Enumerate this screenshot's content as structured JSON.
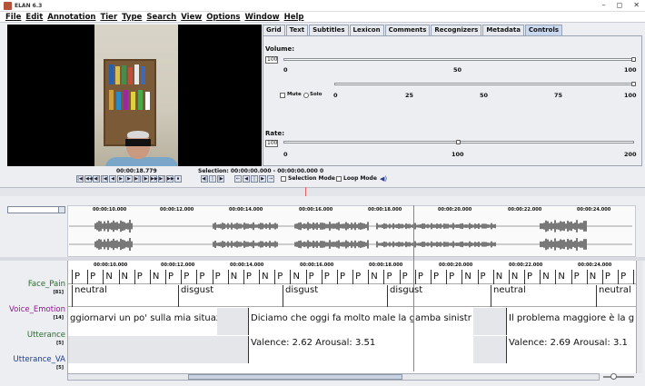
{
  "window": {
    "title": "ELAN 6.3",
    "controls": [
      "–",
      "◻",
      "✕"
    ]
  },
  "menu": [
    "File",
    "Edit",
    "Annotation",
    "Tier",
    "Type",
    "Search",
    "View",
    "Options",
    "Window",
    "Help"
  ],
  "player": {
    "media_time": "00:00:18.779",
    "selection": "Selection: 00:00:00.000 - 00:00:00.000  0",
    "selection_mode": "Selection Mode",
    "loop_mode": "Loop Mode"
  },
  "tabs": [
    "Grid",
    "Text",
    "Subtitles",
    "Lexicon",
    "Comments",
    "Recognizers",
    "Metadata",
    "Controls"
  ],
  "active_tab": "Controls",
  "controls": {
    "volume_label": "Volume:",
    "volume_value": "100",
    "volume_ticks": [
      "0",
      "50",
      "100"
    ],
    "volume_level": 100,
    "mute_label": "Mute",
    "solo_label": "Solo",
    "channel_ticks": [
      "0",
      "25",
      "50",
      "75",
      "100"
    ],
    "channel_level": 100,
    "rate_label": "Rate:",
    "rate_value": "100",
    "rate_ticks": [
      "0",
      "100",
      "200"
    ],
    "rate_level": 100
  },
  "timeline": {
    "timestamps": [
      "00:00:10.000",
      "00:00:12.000",
      "00:00:14.000",
      "00:00:16.000",
      "00:00:18.000",
      "00:00:20.000",
      "00:00:22.000",
      "00:00:24.000"
    ]
  },
  "tiers": [
    {
      "name": "Face_Pain",
      "count": "[81]",
      "color": "#2a6a2a"
    },
    {
      "name": "Voice_Emotion",
      "count": "[14]",
      "color": "#8a1a8a"
    },
    {
      "name": "Utterance",
      "count": "[5]",
      "color": "#2a6a2a"
    },
    {
      "name": "Utterance_VA",
      "count": "[5]",
      "color": "#1a3a8a"
    }
  ],
  "face_pain": [
    "P",
    "P",
    "N",
    "N",
    "P",
    "N",
    "P",
    "P",
    "P",
    "P",
    "N",
    "P",
    "N",
    "P",
    "N",
    "P",
    "P",
    "P",
    "P",
    "N",
    "P",
    "P",
    "P",
    "P",
    "P",
    "N",
    "P",
    "N",
    "N",
    "P",
    "N",
    "N",
    "P",
    "N",
    "P",
    "P",
    "F"
  ],
  "voice_emotion": [
    "neutral",
    "disgust",
    "disgust",
    "disgust",
    "neutral",
    "neutral"
  ],
  "utterances": [
    "ggiornarvi un po' sulla mia situazi",
    "Diciamo che oggi fa molto male la gamba sinistr",
    "Il problema maggiore è la g"
  ],
  "utterance_va": [
    "Valence: 2.62    Arousal: 3.51",
    "Valence: 2.69    Arousal: 3.1"
  ]
}
